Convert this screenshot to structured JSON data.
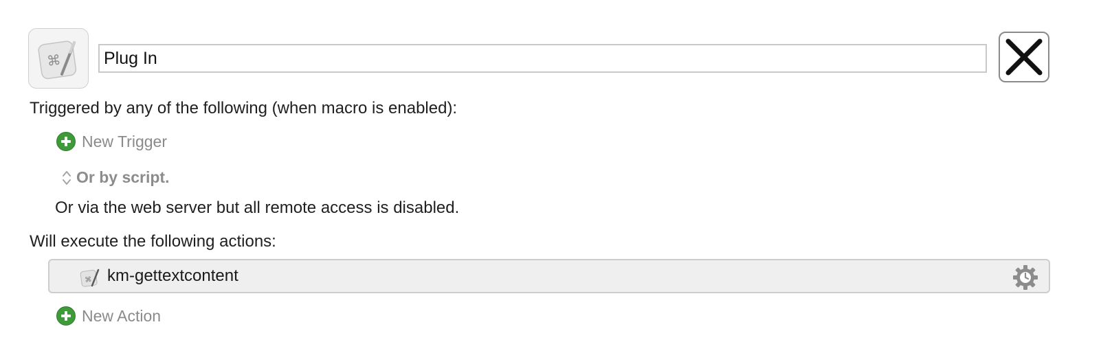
{
  "macro": {
    "name": "Plug In",
    "icon": "keyboard-maestro-icon"
  },
  "close_icon": "close-x-icon",
  "triggers": {
    "heading": "Triggered by any of the following (when macro is enabled):",
    "new_trigger_label": "New Trigger",
    "script_label": "Or by script.",
    "web_server_text": "Or via the web server but all remote access is disabled."
  },
  "actions": {
    "heading": "Will execute the following actions:",
    "items": [
      {
        "label": "km-gettextcontent",
        "icon": "keyboard-maestro-icon",
        "menu_icon": "gear-icon"
      }
    ],
    "new_action_label": "New Action"
  },
  "colors": {
    "add_green": "#3f9a3a",
    "muted_text": "#8a8a8a",
    "action_row_bg": "#efefef"
  }
}
